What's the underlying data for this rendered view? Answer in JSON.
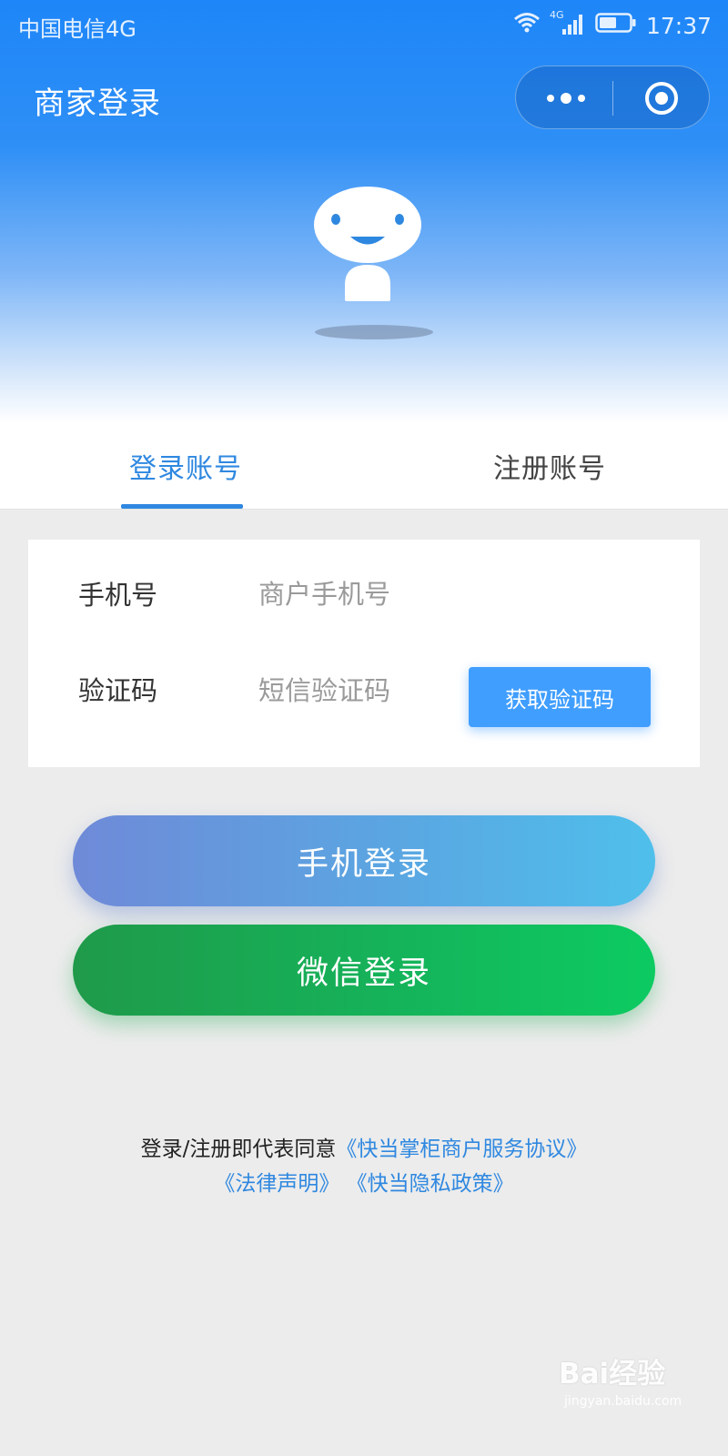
{
  "status_bar": {
    "carrier": "中国电信4G",
    "network": "4G",
    "time": "17:37"
  },
  "nav": {
    "title": "商家登录"
  },
  "tabs": [
    {
      "label": "登录账号",
      "active": true
    },
    {
      "label": "注册账号",
      "active": false
    }
  ],
  "form": {
    "phone": {
      "label": "手机号",
      "placeholder": "商户手机号",
      "value": ""
    },
    "code": {
      "label": "验证码",
      "placeholder": "短信验证码",
      "value": ""
    },
    "get_code_label": "获取验证码"
  },
  "buttons": {
    "phone_login": "手机登录",
    "wechat_login": "微信登录"
  },
  "agreement": {
    "prefix": "登录/注册即代表同意",
    "link_service": "《快当掌柜商户服务协议》",
    "link_legal": "《法律声明》",
    "link_privacy": "《快当隐私政策》"
  },
  "watermark": {
    "logo": "Bai经验",
    "sub": "jingyan.baidu.com"
  },
  "colors": {
    "primary": "#2f88e0",
    "header_blue": "#1e86f8",
    "button_blue": "#409eff",
    "wechat_green": "#15b35a",
    "background": "#ececec"
  },
  "icons": [
    "wifi-icon",
    "signal-icon",
    "battery-icon",
    "more-dots-icon",
    "close-target-icon",
    "mascot-icon"
  ]
}
